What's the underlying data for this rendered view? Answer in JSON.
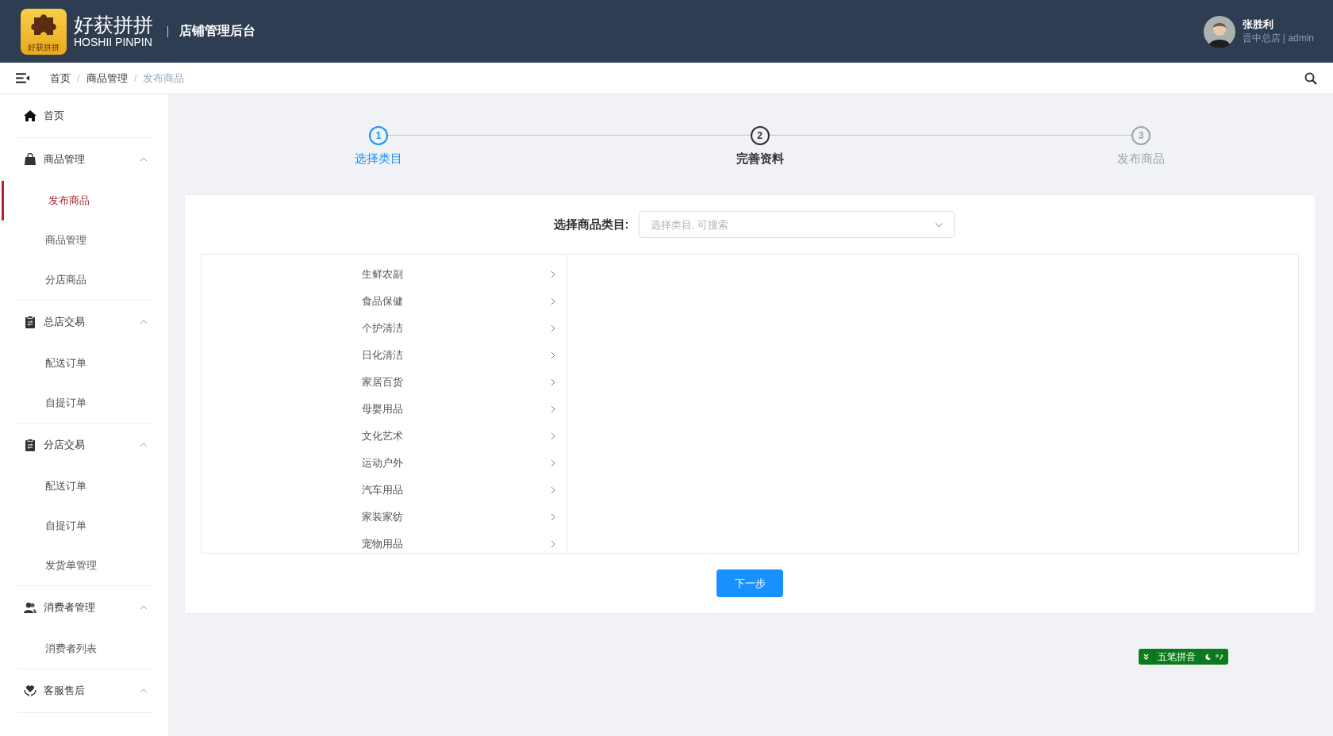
{
  "header": {
    "logo": {
      "badge_text": "好获拼拼",
      "name": "好获拼拼",
      "subtitle": "HOSHII PINPIN"
    },
    "system_title": "店铺管理后台",
    "user": {
      "name": "张胜利",
      "role": "晋中总店 | admin"
    }
  },
  "breadcrumb": [
    {
      "kind": "link",
      "label": "首页"
    },
    {
      "kind": "separator",
      "label": "/"
    },
    {
      "kind": "link",
      "label": "商品管理"
    },
    {
      "kind": "separator",
      "label": "/"
    },
    {
      "kind": "current",
      "label": "发布商品"
    }
  ],
  "sidebar": {
    "items": [
      {
        "kind": "link",
        "label": "首页"
      },
      {
        "kind": "group",
        "label": "商品管理",
        "expanded": true,
        "children": [
          {
            "label": "发布商品",
            "selected": true
          },
          {
            "label": "商品管理",
            "selected": false
          },
          {
            "label": "分店商品",
            "selected": false
          }
        ]
      },
      {
        "kind": "group",
        "label": "总店交易",
        "expanded": true,
        "children": [
          {
            "label": "配送订单",
            "selected": false
          },
          {
            "label": "自提订单",
            "selected": false
          }
        ]
      },
      {
        "kind": "group",
        "label": "分店交易",
        "expanded": true,
        "children": [
          {
            "label": "配送订单",
            "selected": false
          },
          {
            "label": "自提订单",
            "selected": false
          },
          {
            "label": "发货单管理",
            "selected": false
          }
        ]
      },
      {
        "kind": "group",
        "label": "消费者管理",
        "expanded": true,
        "children": [
          {
            "label": "消费者列表",
            "selected": false
          }
        ]
      },
      {
        "kind": "group",
        "label": "客服售后",
        "expanded": true
      }
    ]
  },
  "steps": [
    {
      "number": "1",
      "label": "选择类目",
      "done": true,
      "selected": false
    },
    {
      "number": "2",
      "label": "完善资料",
      "done": false,
      "selected": true
    },
    {
      "number": "3",
      "label": "发布商品",
      "done": false,
      "selected": false
    }
  ],
  "category_form": {
    "label": "选择商品类目:",
    "placeholder": "选择类目, 可搜索"
  },
  "categories": [
    {
      "label": "生鲜农副"
    },
    {
      "label": "食品保健"
    },
    {
      "label": "个护清洁"
    },
    {
      "label": "日化清洁"
    },
    {
      "label": "家居百货"
    },
    {
      "label": "母婴用品"
    },
    {
      "label": "文化艺术"
    },
    {
      "label": "运动户外"
    },
    {
      "label": "汽车用品"
    },
    {
      "label": "家装家纺"
    },
    {
      "label": "宠物用品"
    }
  ],
  "next_button": "下一步",
  "ime_toolbar": {
    "label": "五笔拼音"
  }
}
